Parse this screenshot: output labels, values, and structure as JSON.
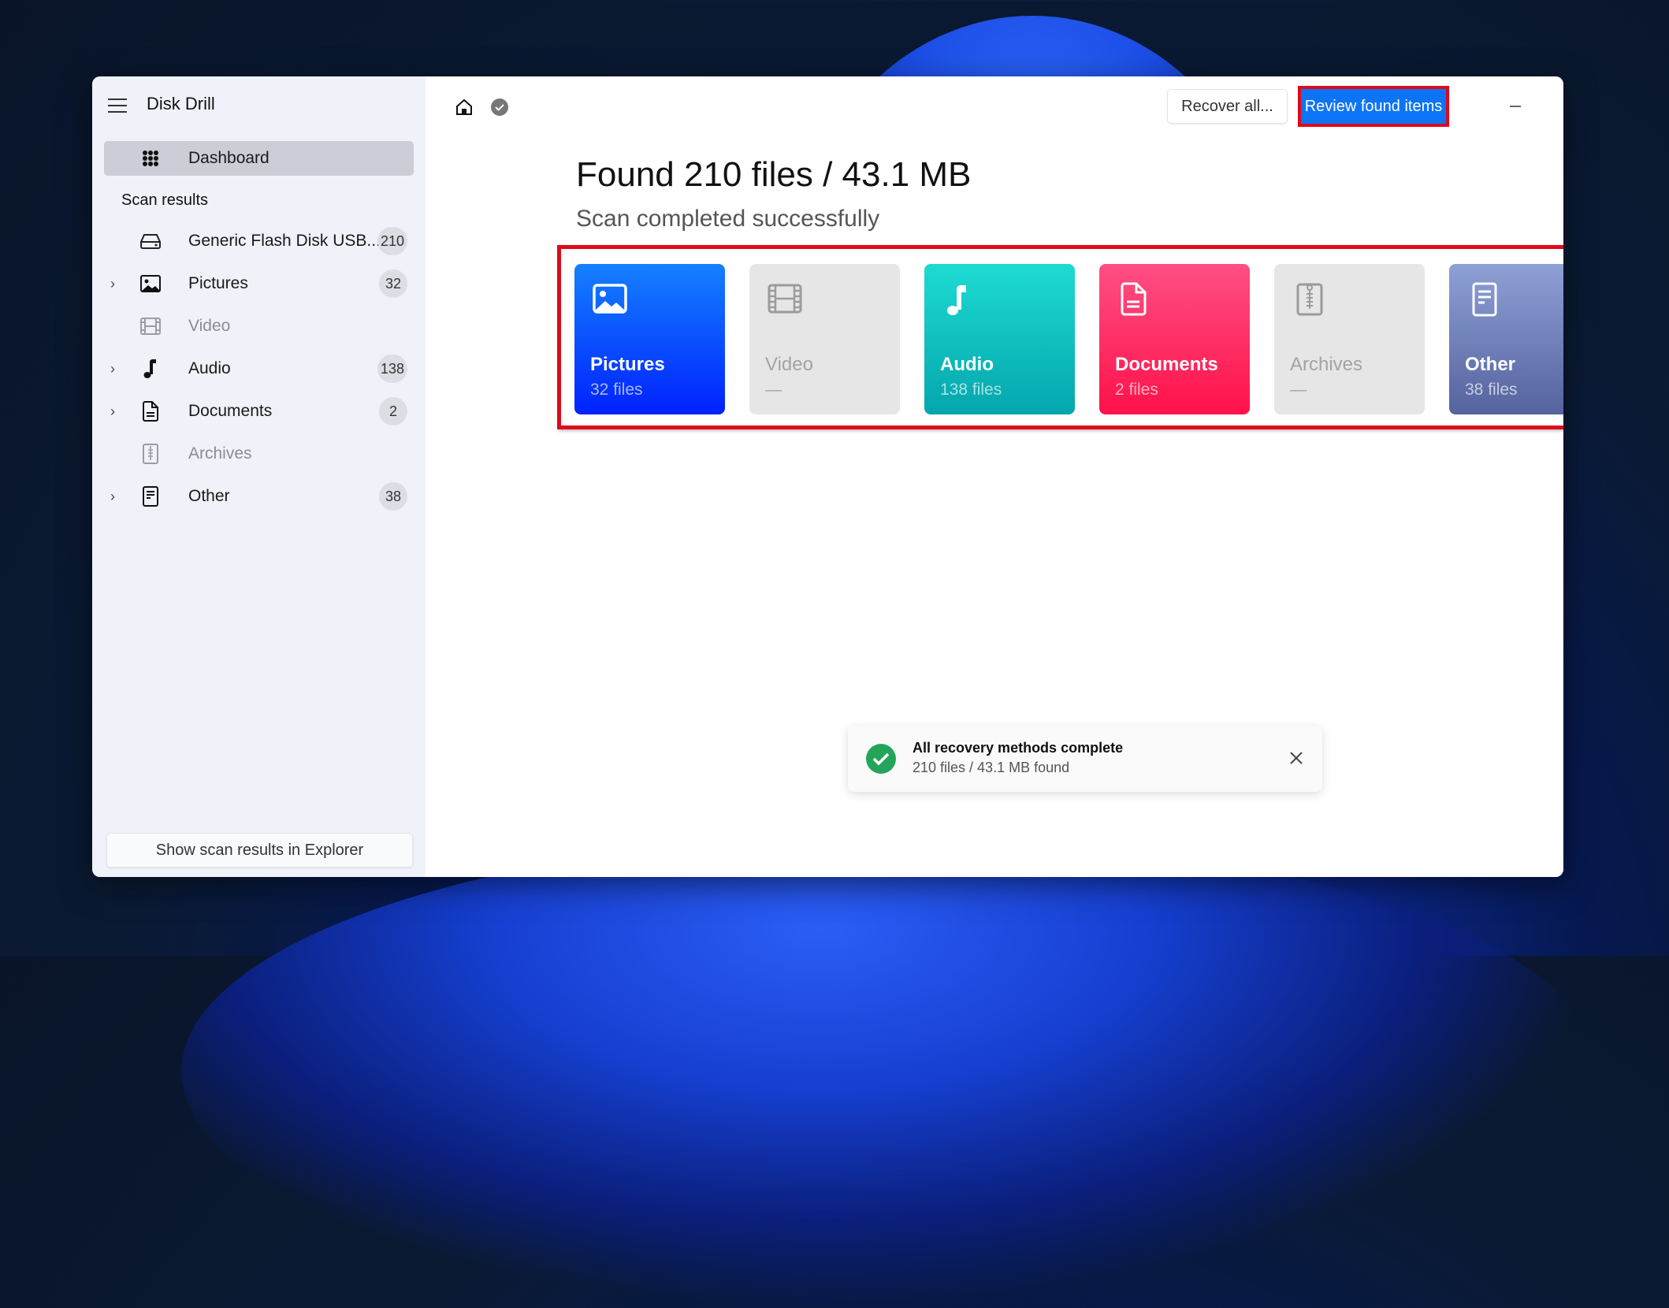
{
  "app": {
    "title": "Disk Drill"
  },
  "sidebar": {
    "dashboard_label": "Dashboard",
    "section_label": "Scan results",
    "items": [
      {
        "label": "Generic Flash Disk USB...",
        "count": "210",
        "icon": "drive-icon",
        "expandable": false,
        "enabled": true
      },
      {
        "label": "Pictures",
        "count": "32",
        "icon": "picture-icon",
        "expandable": true,
        "enabled": true
      },
      {
        "label": "Video",
        "count": "",
        "icon": "film-icon",
        "expandable": false,
        "enabled": false
      },
      {
        "label": "Audio",
        "count": "138",
        "icon": "music-note-icon",
        "expandable": true,
        "enabled": true
      },
      {
        "label": "Documents",
        "count": "2",
        "icon": "document-icon",
        "expandable": true,
        "enabled": true
      },
      {
        "label": "Archives",
        "count": "",
        "icon": "archive-zip-icon",
        "expandable": false,
        "enabled": false
      },
      {
        "label": "Other",
        "count": "38",
        "icon": "other-file-icon",
        "expandable": true,
        "enabled": true
      }
    ],
    "explorer_button": "Show scan results in Explorer"
  },
  "toolbar": {
    "recover_all": "Recover all...",
    "review_found": "Review found items"
  },
  "main": {
    "headline": "Found 210 files / 43.1 MB",
    "subheadline": "Scan completed successfully",
    "cards": [
      {
        "title": "Pictures",
        "subtitle": "32 files",
        "enabled": true,
        "gradient": [
          "#1580ff",
          "#0022ff"
        ]
      },
      {
        "title": "Video",
        "subtitle": "—",
        "enabled": false
      },
      {
        "title": "Audio",
        "subtitle": "138 files",
        "enabled": true,
        "gradient": [
          "#1ddbd2",
          "#04a6ad"
        ]
      },
      {
        "title": "Documents",
        "subtitle": "2 files",
        "enabled": true,
        "gradient": [
          "#ff4f84",
          "#ff1149"
        ]
      },
      {
        "title": "Archives",
        "subtitle": "—",
        "enabled": false
      },
      {
        "title": "Other",
        "subtitle": "38 files",
        "enabled": true,
        "gradient": [
          "#8ea0d6",
          "#55639e"
        ]
      }
    ]
  },
  "toast": {
    "title": "All recovery methods complete",
    "message": "210 files / 43.1 MB found"
  },
  "colors": {
    "accent": "#0d74f5",
    "highlight": "#e0081b",
    "success": "#22a55a"
  }
}
